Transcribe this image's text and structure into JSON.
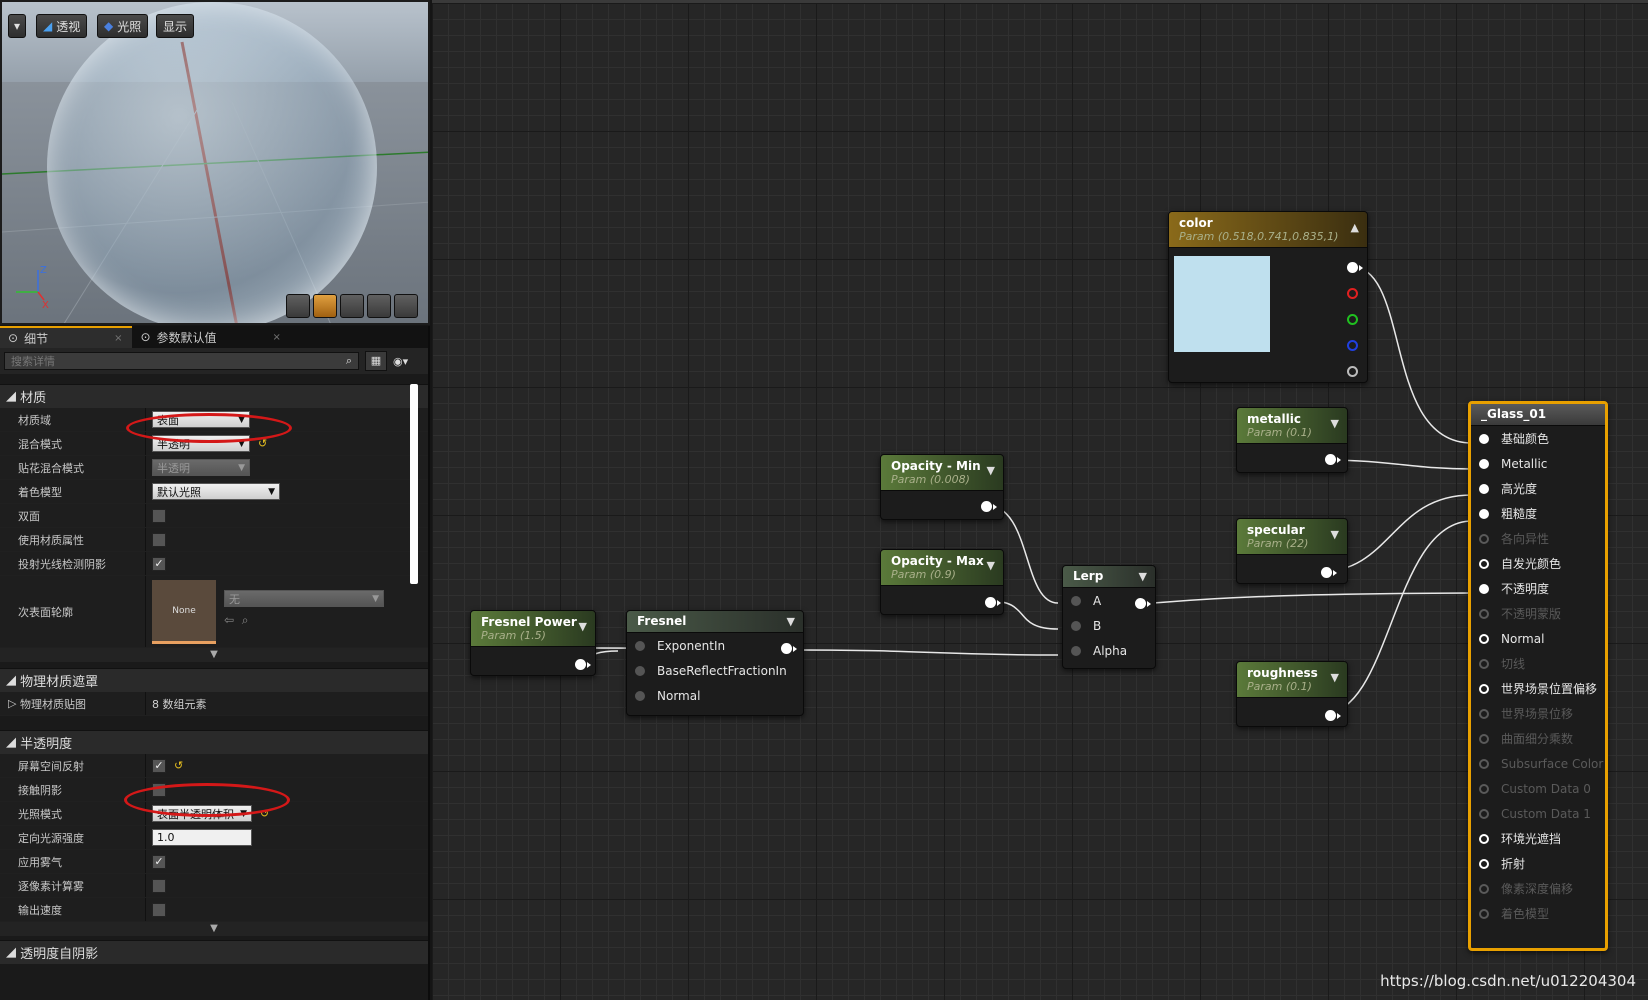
{
  "viewport": {
    "toolbar": [
      "透视",
      "光照",
      "显示"
    ],
    "axes": {
      "z": "Z",
      "x": "X"
    }
  },
  "details_panel": {
    "tabs": [
      "细节",
      "参数默认值"
    ],
    "search_placeholder": "搜索详情",
    "categories": {
      "material": "材质",
      "physical": "物理材质遮罩",
      "translucency": "半透明度",
      "translucency_self_shadow": "透明度自阴影"
    },
    "material_props": {
      "domain": {
        "label": "材质域",
        "value": "表面"
      },
      "blend_mode": {
        "label": "混合模式",
        "value": "半透明"
      },
      "decal_blend": {
        "label": "贴花混合模式",
        "value": "半透明"
      },
      "shading_model": {
        "label": "着色模型",
        "value": "默认光照"
      },
      "two_sided": {
        "label": "双面",
        "checked": false
      },
      "use_material_attributes": {
        "label": "使用材质属性",
        "checked": false
      },
      "cast_ray_traced_shadows": {
        "label": "投射光线检测阴影",
        "checked": true
      },
      "subsurface_profile": {
        "label": "次表面轮廓",
        "thumb": "None",
        "value": "无"
      }
    },
    "physical_props": {
      "phys_material_map": {
        "label": "物理材质贴图",
        "value": "8 数组元素"
      }
    },
    "translucency_props": {
      "screen_space_reflections": {
        "label": "屏幕空间反射",
        "checked": true
      },
      "contact_shadows": {
        "label": "接触阴影",
        "checked": false
      },
      "lighting_mode": {
        "label": "光照模式",
        "value": "表面半透明体积"
      },
      "directional_intensity": {
        "label": "定向光源强度",
        "value": "1.0"
      },
      "apply_fogging": {
        "label": "应用雾气",
        "checked": true
      },
      "compute_fog_per_pixel": {
        "label": "逐像素计算雾",
        "checked": false
      },
      "output_velocity": {
        "label": "输出速度",
        "checked": false
      }
    }
  },
  "graph": {
    "nodes": {
      "color": {
        "title": "color",
        "sub": "Param (0.518,0.741,0.835,1)",
        "swatch": "#bfe0ee"
      },
      "metallic": {
        "title": "metallic",
        "sub": "Param (0.1)"
      },
      "specular": {
        "title": "specular",
        "sub": "Param (22)"
      },
      "roughness": {
        "title": "roughness",
        "sub": "Param (0.1)"
      },
      "opacity_min": {
        "title": "Opacity - Min",
        "sub": "Param (0.008)"
      },
      "opacity_max": {
        "title": "Opacity - Max",
        "sub": "Param (0.9)"
      },
      "lerp": {
        "title": "Lerp",
        "inputs": [
          "A",
          "B",
          "Alpha"
        ]
      },
      "fresnel_power": {
        "title": "Fresnel Power",
        "sub": "Param (1.5)"
      },
      "fresnel": {
        "title": "Fresnel",
        "inputs": [
          "ExponentIn",
          "BaseReflectFractionIn",
          "Normal"
        ]
      }
    },
    "result_node": {
      "title": "_Glass_01",
      "pins": [
        {
          "label": "基础颜色",
          "state": "on"
        },
        {
          "label": "Metallic",
          "state": "on"
        },
        {
          "label": "高光度",
          "state": "on"
        },
        {
          "label": "粗糙度",
          "state": "on"
        },
        {
          "label": "各向异性",
          "state": "off"
        },
        {
          "label": "自发光颜色",
          "state": "open"
        },
        {
          "label": "不透明度",
          "state": "on"
        },
        {
          "label": "不透明蒙版",
          "state": "off"
        },
        {
          "label": "Normal",
          "state": "open"
        },
        {
          "label": "切线",
          "state": "off"
        },
        {
          "label": "世界场景位置偏移",
          "state": "open"
        },
        {
          "label": "世界场景位移",
          "state": "off"
        },
        {
          "label": "曲面细分乘数",
          "state": "off"
        },
        {
          "label": "Subsurface Color",
          "state": "off"
        },
        {
          "label": "Custom Data 0",
          "state": "off"
        },
        {
          "label": "Custom Data 1",
          "state": "off"
        },
        {
          "label": "环境光遮挡",
          "state": "open"
        },
        {
          "label": "折射",
          "state": "open"
        },
        {
          "label": "像素深度偏移",
          "state": "off"
        },
        {
          "label": "着色模型",
          "state": "off"
        }
      ]
    },
    "watermark": "https://blog.csdn.net/u012204304"
  }
}
